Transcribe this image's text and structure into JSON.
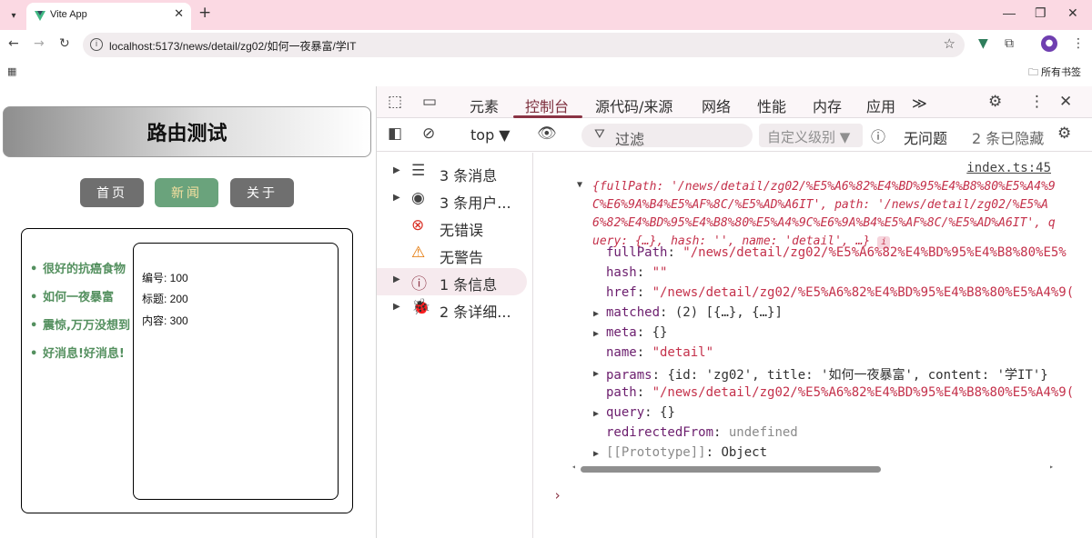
{
  "browser": {
    "tab_title": "Vite App",
    "url": "localhost:5173/news/detail/zg02/如何一夜暴富/学IT",
    "bookmarks_label": "所有书签",
    "new_tab": "+",
    "close_tab": "✕",
    "tab_menu": "▾",
    "win_min": "—",
    "win_max": "❐",
    "win_close": "✕"
  },
  "page": {
    "title": "路由测试",
    "nav": [
      {
        "label": "首页",
        "active": false
      },
      {
        "label": "新闻",
        "active": true
      },
      {
        "label": "关于",
        "active": false
      }
    ],
    "news": [
      "很好的抗癌食物",
      "如何一夜暴富",
      "震惊,万万没想到",
      "好消息!好消息!"
    ],
    "detail": {
      "id_line": "编号: 100",
      "title_line": "标题: 200",
      "content_line": "内容: 300"
    }
  },
  "devtools": {
    "tabs": [
      {
        "label": "元素"
      },
      {
        "label": "控制台",
        "active": true
      },
      {
        "label": "源代码/来源"
      },
      {
        "label": "网络"
      },
      {
        "label": "性能"
      },
      {
        "label": "内存"
      },
      {
        "label": "应用"
      }
    ],
    "more_tabs": "≫",
    "context": "top ▼",
    "filter_placeholder": "过滤",
    "levels": "自定义级别 ▼",
    "issues": "无问题",
    "hidden": "2 条已隐藏",
    "sidebar": [
      {
        "label": "3 条消息",
        "icon": "list-icon"
      },
      {
        "label": "3 条用户...",
        "icon": "user-icon"
      },
      {
        "label": "无错误",
        "icon": "error-icon"
      },
      {
        "label": "无警告",
        "icon": "warning-icon"
      },
      {
        "label": "1 条信息",
        "icon": "info-icon"
      },
      {
        "label": "2 条详细...",
        "icon": "bug-icon"
      }
    ],
    "console": {
      "source": "index.ts:45",
      "preview_line1": "{fullPath: '/news/detail/zg02/%E5%A6%82%E4%BD%95%E4%B8%80%E5%A4%9C%E6%9A%B4%E5%AF%8C/%E5%AD%A6IT', path: '/news/detail/zg02/%E5%A6%82%E4%BD%95%E4%B8%80%E5%A4%9C%E6%9A%B4%E5%AF%8C/%E5%AD%A6IT', query: {…}, hash: '', name: 'detail',  …}",
      "props": [
        {
          "key": "fullPath",
          "value": "\"/news/detail/zg02/%E5%A6%82%E4%BD%95%E4%B8%80%E5%",
          "expandable": false
        },
        {
          "key": "hash",
          "value": "\"\"",
          "expandable": false
        },
        {
          "key": "href",
          "value": "\"/news/detail/zg02/%E5%A6%82%E4%BD%95%E4%B8%80%E5%A4%9(",
          "expandable": false
        },
        {
          "key": "matched",
          "value": "(2)  [{…}, {…}]",
          "expandable": true
        },
        {
          "key": "meta",
          "value": "{}",
          "expandable": true
        },
        {
          "key": "name",
          "value": "\"detail\"",
          "expandable": false
        },
        {
          "key": "params",
          "value": "{id: 'zg02', title: '如何一夜暴富', content: '学IT'}",
          "expandable": true
        },
        {
          "key": "path",
          "value": "\"/news/detail/zg02/%E5%A6%82%E4%BD%95%E4%B8%80%E5%A4%9(",
          "expandable": false
        },
        {
          "key": "query",
          "value": "{}",
          "expandable": true
        },
        {
          "key": "redirectedFrom",
          "value": "undefined",
          "expandable": false
        },
        {
          "key": "[[Prototype]]",
          "value": "Object",
          "expandable": true
        }
      ],
      "prompt": "›"
    }
  },
  "colors": {
    "tabstrip": "#fbd9e3",
    "active_nav": "#6aa37c",
    "news_text": "#54905f",
    "devtools_accent": "#8a3344"
  }
}
